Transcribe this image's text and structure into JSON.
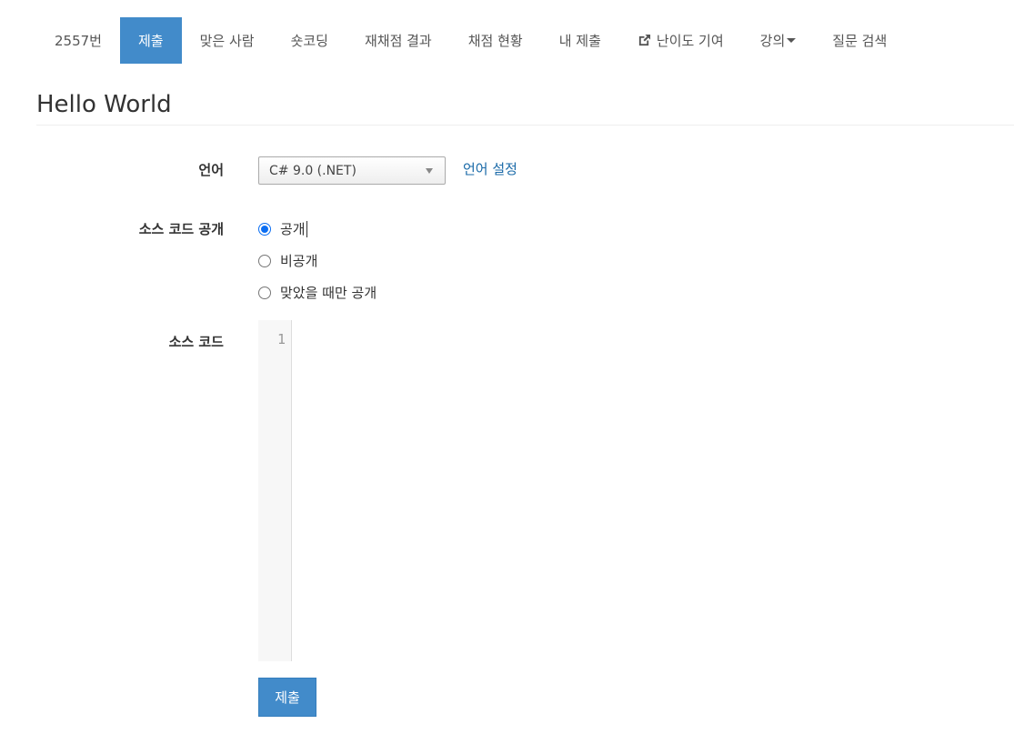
{
  "nav": {
    "items": [
      {
        "label": "2557번"
      },
      {
        "label": "제출"
      },
      {
        "label": "맞은 사람"
      },
      {
        "label": "숏코딩"
      },
      {
        "label": "재채점 결과"
      },
      {
        "label": "채점 현황"
      },
      {
        "label": "내 제출"
      },
      {
        "label": "난이도 기여"
      },
      {
        "label": "강의"
      },
      {
        "label": "질문 검색"
      }
    ]
  },
  "page": {
    "title": "Hello World"
  },
  "form": {
    "language_label": "언어",
    "language_value": "C# 9.0 (.NET)",
    "language_settings_link": "언어 설정",
    "visibility_label": "소스 코드 공개",
    "visibility_options": [
      {
        "label": "공개",
        "checked": true
      },
      {
        "label": "비공개",
        "checked": false
      },
      {
        "label": "맞았을 때만 공개",
        "checked": false
      }
    ],
    "source_label": "소스 코드",
    "line_number": "1",
    "submit_label": "제출"
  },
  "colors": {
    "accent": "#428bca",
    "link": "#1a6aa8",
    "radio_checked": "#0b6ef2"
  },
  "icons": {
    "external_link": "external-link-icon",
    "dropdown_caret": "caret-down-icon"
  }
}
